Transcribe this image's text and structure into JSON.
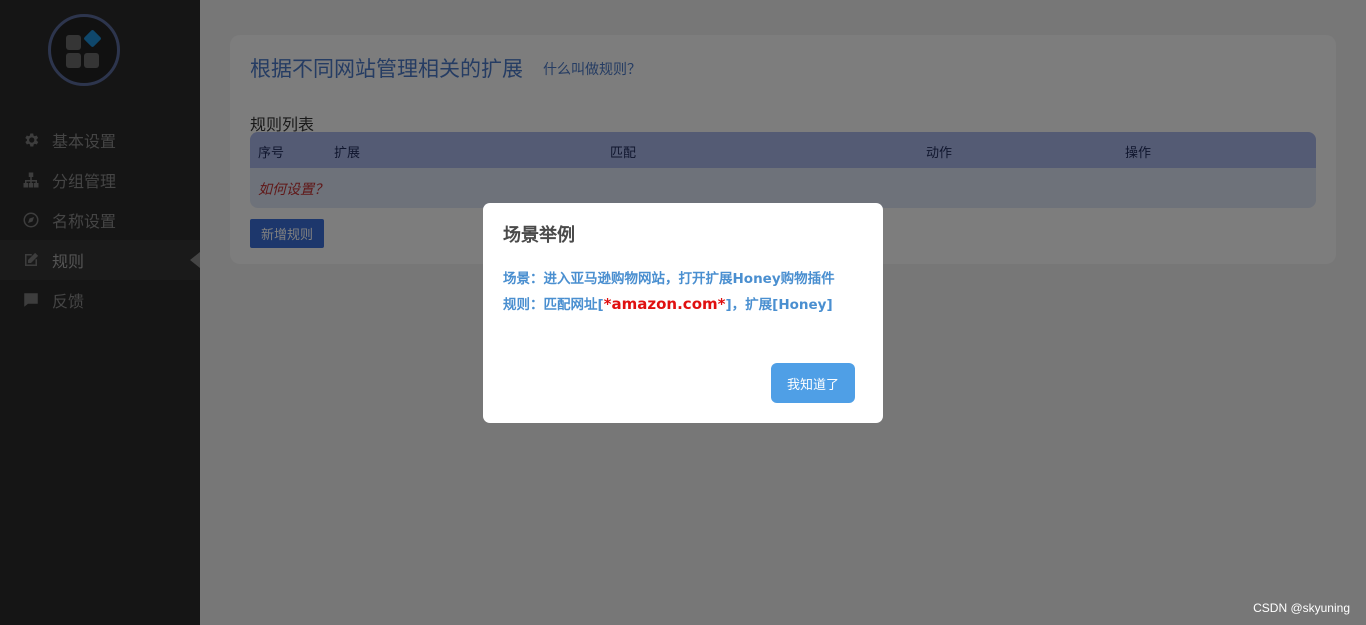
{
  "sidebar": {
    "items": [
      {
        "label": "基本设置",
        "icon": "gear-icon"
      },
      {
        "label": "分组管理",
        "icon": "sitemap-icon"
      },
      {
        "label": "名称设置",
        "icon": "compass-icon"
      },
      {
        "label": "规则",
        "icon": "edit-icon",
        "active": true
      },
      {
        "label": "反馈",
        "icon": "comment-icon"
      }
    ]
  },
  "main": {
    "title": "根据不同网站管理相关的扩展",
    "help_link": "什么叫做规则？",
    "section_title": "规则列表",
    "table": {
      "headers": [
        "序号",
        "扩展",
        "匹配",
        "动作",
        "操作"
      ],
      "empty_hint": "如何设置？"
    },
    "add_button": "新增规则"
  },
  "modal": {
    "title": "场景举例",
    "line1": "场景：进入亚马逊购物网站，打开扩展Honey购物插件",
    "line2_prefix": "规则：匹配网址[",
    "line2_highlight": "*amazon.com*",
    "line2_suffix": "]，扩展[Honey]",
    "ok_button": "我知道了"
  },
  "watermark": "CSDN @skyuning",
  "colors": {
    "accent": "#4a78c6",
    "modal_text": "#4a8fd0",
    "highlight": "#e01010",
    "button": "#4f9fe6"
  }
}
